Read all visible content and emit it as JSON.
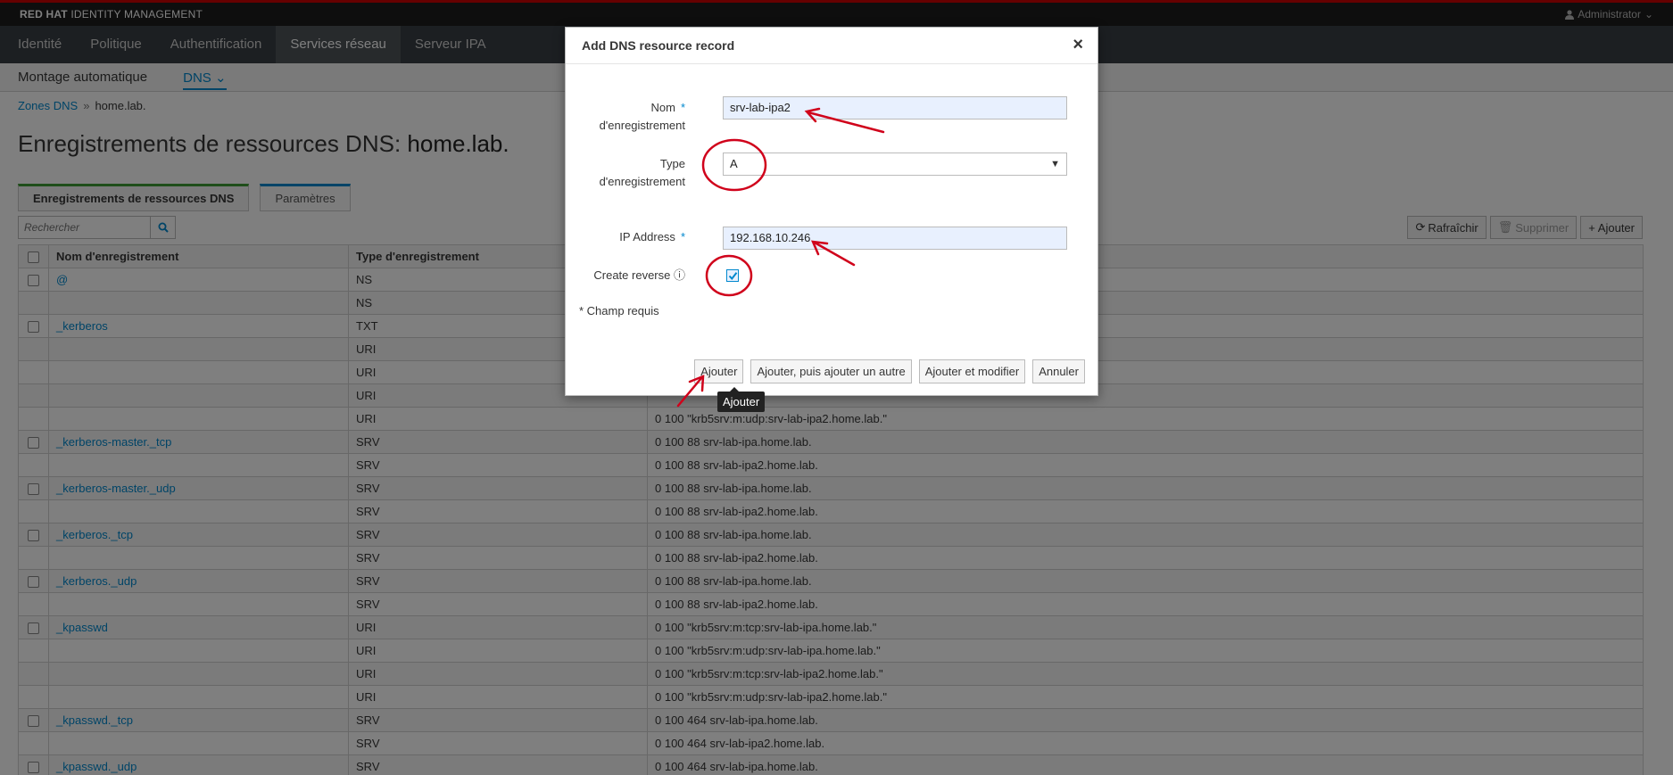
{
  "header": {
    "brand_bold": "RED HAT",
    "brand_rest": "IDENTITY MANAGEMENT",
    "user": "Administrator"
  },
  "main_nav": [
    "Identité",
    "Politique",
    "Authentification",
    "Services réseau",
    "Serveur IPA"
  ],
  "sub_nav": [
    "Montage automatique",
    "DNS"
  ],
  "breadcrumb": {
    "link": "Zones DNS",
    "sep": "»",
    "current": "home.lab."
  },
  "page": {
    "title": "Enregistrements de ressources DNS:",
    "zone": "home.lab."
  },
  "tabs": [
    "Enregistrements de ressources DNS",
    "Paramètres"
  ],
  "search": {
    "placeholder": "Rechercher"
  },
  "toolbar": {
    "refresh": "Rafraîchir",
    "delete": "Supprimer",
    "add": "Ajouter"
  },
  "table": {
    "columns": [
      "Nom d'enregistrement",
      "Type d'enregistrement",
      ""
    ],
    "rows": [
      {
        "check": true,
        "name": "@",
        "type": "NS",
        "data": ""
      },
      {
        "check": false,
        "name": "",
        "type": "NS",
        "data": ""
      },
      {
        "check": true,
        "name": "_kerberos",
        "type": "TXT",
        "data": ""
      },
      {
        "check": false,
        "name": "",
        "type": "URI",
        "data": ""
      },
      {
        "check": false,
        "name": "",
        "type": "URI",
        "data": ""
      },
      {
        "check": false,
        "name": "",
        "type": "URI",
        "data": ""
      },
      {
        "check": false,
        "name": "",
        "type": "URI",
        "data": "0 100 \"krb5srv:m:udp:srv-lab-ipa2.home.lab.\""
      },
      {
        "check": true,
        "name": "_kerberos-master._tcp",
        "type": "SRV",
        "data": "0 100 88 srv-lab-ipa.home.lab."
      },
      {
        "check": false,
        "name": "",
        "type": "SRV",
        "data": "0 100 88 srv-lab-ipa2.home.lab."
      },
      {
        "check": true,
        "name": "_kerberos-master._udp",
        "type": "SRV",
        "data": "0 100 88 srv-lab-ipa.home.lab."
      },
      {
        "check": false,
        "name": "",
        "type": "SRV",
        "data": "0 100 88 srv-lab-ipa2.home.lab."
      },
      {
        "check": true,
        "name": "_kerberos._tcp",
        "type": "SRV",
        "data": "0 100 88 srv-lab-ipa.home.lab."
      },
      {
        "check": false,
        "name": "",
        "type": "SRV",
        "data": "0 100 88 srv-lab-ipa2.home.lab."
      },
      {
        "check": true,
        "name": "_kerberos._udp",
        "type": "SRV",
        "data": "0 100 88 srv-lab-ipa.home.lab."
      },
      {
        "check": false,
        "name": "",
        "type": "SRV",
        "data": "0 100 88 srv-lab-ipa2.home.lab."
      },
      {
        "check": true,
        "name": "_kpasswd",
        "type": "URI",
        "data": "0 100 \"krb5srv:m:tcp:srv-lab-ipa.home.lab.\""
      },
      {
        "check": false,
        "name": "",
        "type": "URI",
        "data": "0 100 \"krb5srv:m:udp:srv-lab-ipa.home.lab.\""
      },
      {
        "check": false,
        "name": "",
        "type": "URI",
        "data": "0 100 \"krb5srv:m:tcp:srv-lab-ipa2.home.lab.\""
      },
      {
        "check": false,
        "name": "",
        "type": "URI",
        "data": "0 100 \"krb5srv:m:udp:srv-lab-ipa2.home.lab.\""
      },
      {
        "check": true,
        "name": "_kpasswd._tcp",
        "type": "SRV",
        "data": "0 100 464 srv-lab-ipa.home.lab."
      },
      {
        "check": false,
        "name": "",
        "type": "SRV",
        "data": "0 100 464 srv-lab-ipa2.home.lab."
      },
      {
        "check": true,
        "name": "_kpasswd._udp",
        "type": "SRV",
        "data": "0 100 464 srv-lab-ipa.home.lab."
      }
    ]
  },
  "dialog": {
    "title": "Add DNS resource record",
    "close": "×",
    "name_label_1": "Nom",
    "name_label_2": "d'enregistrement",
    "name_value": "srv-lab-ipa2",
    "type_label_1": "Type",
    "type_label_2": "d'enregistrement",
    "type_value": "A",
    "ip_label": "IP Address",
    "ip_value": "192.168.10.246",
    "reverse_label": "Create reverse",
    "reverse_checked": true,
    "required_asterisk": "*",
    "required_note": "* Champ requis",
    "buttons": {
      "add": "Ajouter",
      "add_another": "Ajouter, puis ajouter un autre",
      "add_edit": "Ajouter et modifier",
      "cancel": "Annuler"
    },
    "tooltip": "Ajouter"
  },
  "colors": {
    "annotation": "#d0021b",
    "accent": "#0088ce",
    "brand_red": "#cc0000"
  }
}
